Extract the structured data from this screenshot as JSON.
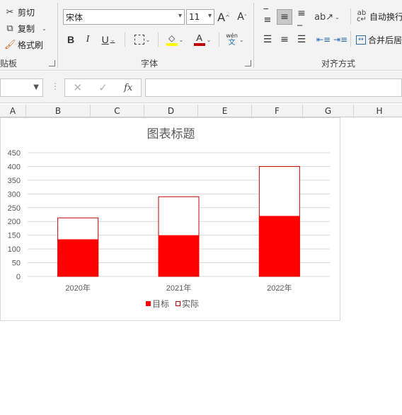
{
  "ribbon": {
    "clipboard": {
      "cut_label": "剪切",
      "copy_label": "复制",
      "format_painter_label": "格式刷",
      "group_label": "剪贴板",
      "cut_icon": "scissors-icon",
      "copy_icon": "copy-icon",
      "format_painter_icon": "brush-icon"
    },
    "font": {
      "font_name": "宋体",
      "font_size": "11",
      "grow_label": "A",
      "shrink_label": "A",
      "bold_label": "B",
      "italic_label": "I",
      "underline_label": "U",
      "phonetic_top": "wén",
      "phonetic_bottom": "文",
      "group_label": "字体",
      "font_color": "#c00000",
      "fill_color": "#ffff00"
    },
    "alignment": {
      "wrap_label": "自动换行",
      "merge_label": "合并后居中",
      "group_label": "对齐方式",
      "selected": "middle-align"
    }
  },
  "formula_bar": {
    "name_box": "",
    "cancel_symbol": "✕",
    "enter_symbol": "✓",
    "fx_label": "fx",
    "formula": ""
  },
  "columns": [
    "A",
    "B",
    "C",
    "D",
    "E",
    "F",
    "G",
    "H"
  ],
  "chart_data": {
    "type": "bar",
    "title": "图表标题",
    "categories": [
      "2020年",
      "2021年",
      "2022年"
    ],
    "series": [
      {
        "name": "目标",
        "values": [
          135,
          150,
          220
        ],
        "color": "#ff0000",
        "style": "filled"
      },
      {
        "name": "实际",
        "values": [
          213,
          290,
          400
        ],
        "color": "#c00000",
        "style": "outline"
      }
    ],
    "ylim": [
      0,
      450
    ],
    "yticks": [
      0,
      50,
      100,
      150,
      200,
      250,
      300,
      350,
      400,
      450
    ],
    "grid": true,
    "legend_position": "bottom",
    "xlabel": "",
    "ylabel": ""
  }
}
